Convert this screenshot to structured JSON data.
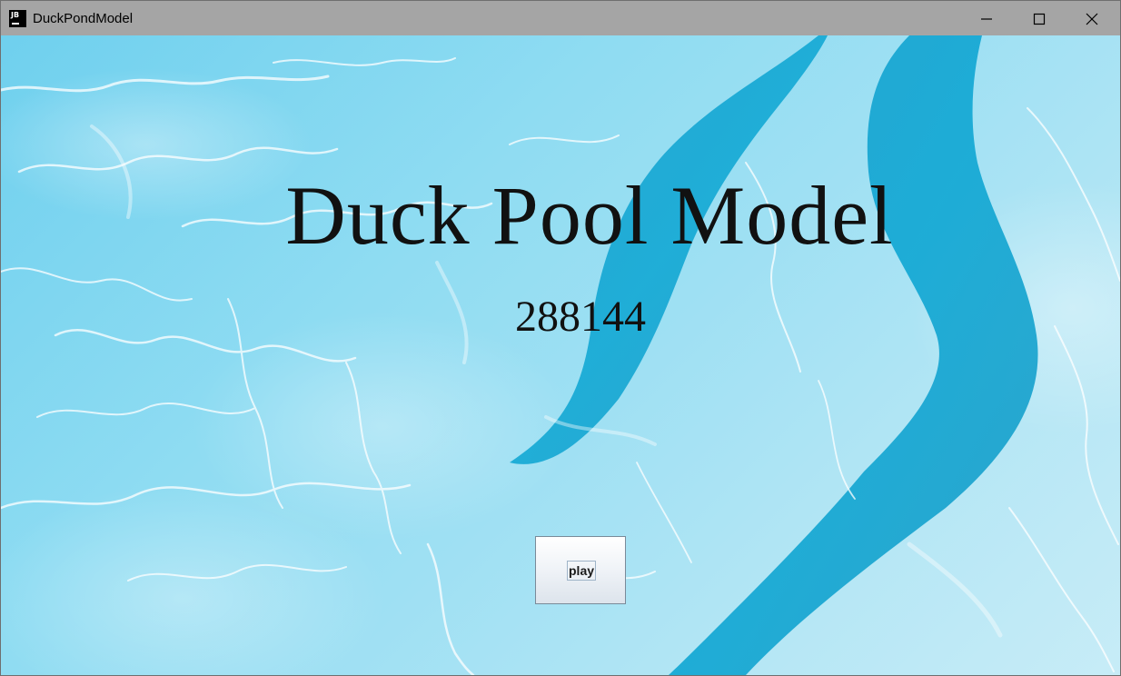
{
  "window": {
    "title": "DuckPondModel",
    "app_icon_text": "JB",
    "controls": [
      "minimize",
      "maximize",
      "close"
    ]
  },
  "main": {
    "heading": "Duck Pool Model",
    "score": "288144",
    "play_button_label": "play"
  },
  "colors": {
    "titlebar": "#a5a5a5",
    "water_light": "#9fe0f3",
    "water_deep": "#1aa6cf",
    "text": "#111111"
  },
  "icons": {
    "app": "jetbrains-app-icon",
    "minimize": "minimize-icon",
    "maximize": "maximize-icon",
    "close": "close-icon"
  }
}
